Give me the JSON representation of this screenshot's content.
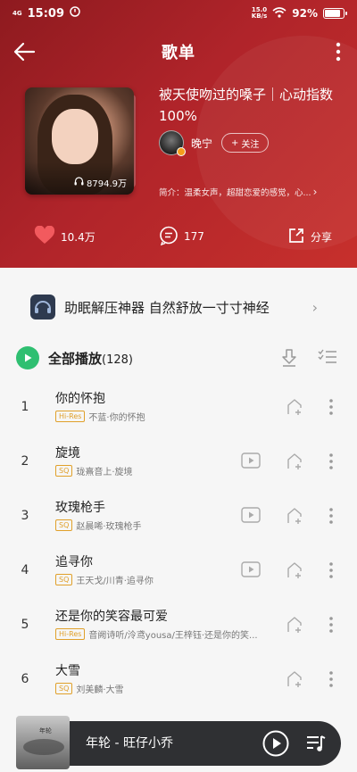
{
  "status_bar": {
    "time": "15:09",
    "network": "4G",
    "speed": "15.0",
    "speed_unit": "KB/s",
    "battery": "92%",
    "battery_level": 0.92
  },
  "nav": {
    "title": "歌单"
  },
  "playlist": {
    "title": "被天使吻过的嗓子｜心动指数100%",
    "plays": "8794.9万",
    "creator": "晚宁",
    "follow_label": "关注",
    "intro": "简介：温柔女声，超甜恋爱的感觉，心..."
  },
  "actions": {
    "likes": "10.4万",
    "comments": "177",
    "share": "分享"
  },
  "promo": {
    "text": "助眠解压神器 自然舒放一寸寸神经"
  },
  "play_all": {
    "label": "全部播放",
    "count": "(128)"
  },
  "songs": [
    {
      "index": "1",
      "title": "你的怀抱",
      "quality": "Hi-Res",
      "artist": "不蓝·你的怀抱",
      "has_mv": false
    },
    {
      "index": "2",
      "title": "旋境",
      "quality": "SQ",
      "artist": "珑熹音上·旋境",
      "has_mv": true
    },
    {
      "index": "3",
      "title": "玫瑰枪手",
      "quality": "SQ",
      "artist": "赵晨唏·玫瑰枪手",
      "has_mv": true
    },
    {
      "index": "4",
      "title": "追寻你",
      "quality": "SQ",
      "artist": "王天戈/川青·追寻你",
      "has_mv": true
    },
    {
      "index": "5",
      "title": "还是你的笑容最可爱",
      "quality": "Hi-Res",
      "artist": "音阙诗听/泠鸢yousa/王梓钰·还是你的笑...",
      "has_mv": false
    },
    {
      "index": "6",
      "title": "大雪",
      "quality": "SQ",
      "artist": "刘美麟·大雪",
      "has_mv": false
    }
  ],
  "mini_player": {
    "title": "年轮 - 旺仔小乔",
    "cover_text": "年轮"
  },
  "colors": {
    "header_red": "#b0242a",
    "play_green": "#2fbf71",
    "quality_gold": "#e0a02a",
    "player_bg": "#2f3033"
  }
}
